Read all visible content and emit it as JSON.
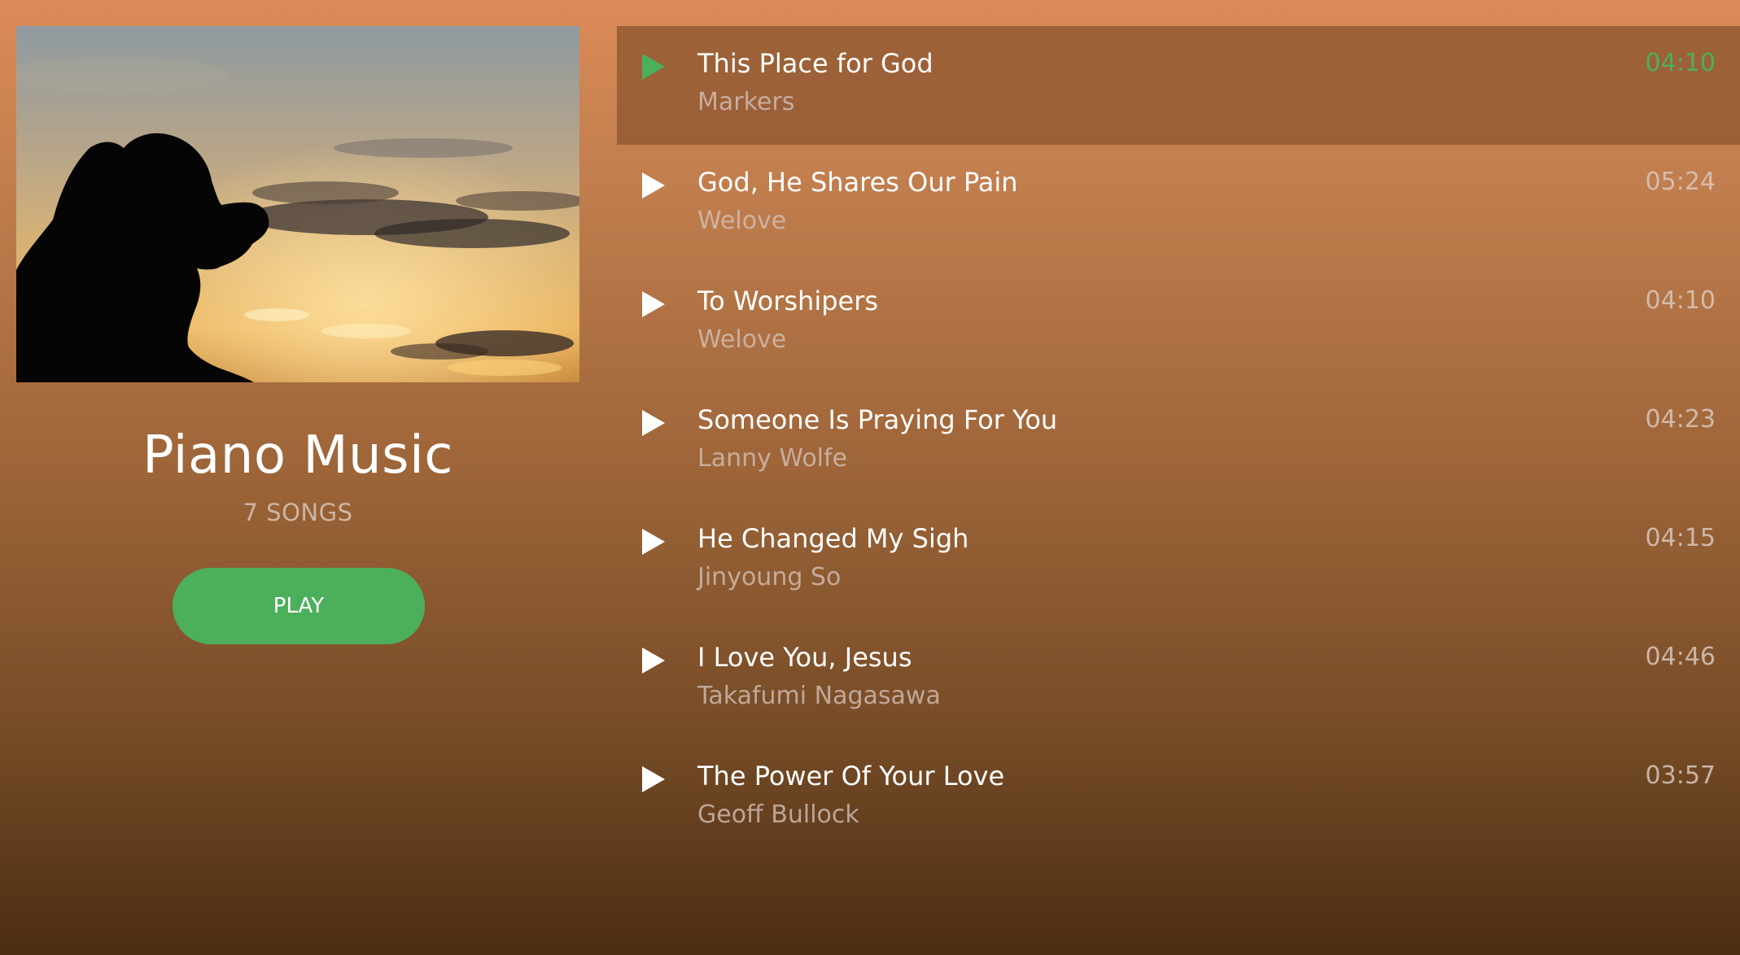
{
  "colors": {
    "accent": "#4caf5c",
    "active_row": "#8f5a34",
    "text_primary": "#ffffff",
    "text_secondary": "#c9b5ab"
  },
  "playlist": {
    "title": "Piano Music",
    "song_count": "7 SONGS",
    "play_label": "PLAY",
    "cover_image": "silhouette-praying-sunset"
  },
  "tracks": [
    {
      "title": "This Place for God",
      "artist": "Markers",
      "duration": "04:10",
      "active": true,
      "icon": "play-icon"
    },
    {
      "title": "God, He Shares Our Pain",
      "artist": "Welove",
      "duration": "05:24",
      "active": false,
      "icon": "play-icon"
    },
    {
      "title": "To Worshipers",
      "artist": "Welove",
      "duration": "04:10",
      "active": false,
      "icon": "play-icon"
    },
    {
      "title": "Someone Is Praying For You",
      "artist": "Lanny Wolfe",
      "duration": "04:23",
      "active": false,
      "icon": "play-icon"
    },
    {
      "title": "He Changed My Sigh",
      "artist": "Jinyoung So",
      "duration": "04:15",
      "active": false,
      "icon": "play-icon"
    },
    {
      "title": "I Love You, Jesus",
      "artist": "Takafumi Nagasawa",
      "duration": "04:46",
      "active": false,
      "icon": "play-icon"
    },
    {
      "title": "The Power Of Your Love",
      "artist": "Geoff Bullock",
      "duration": "03:57",
      "active": false,
      "icon": "play-icon"
    }
  ]
}
